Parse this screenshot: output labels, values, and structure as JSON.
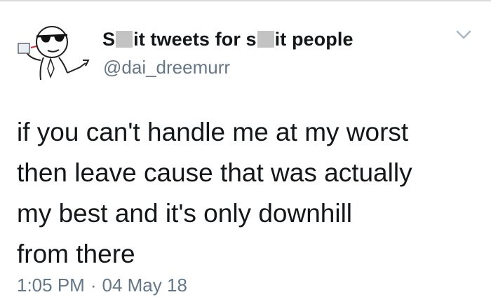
{
  "tweet": {
    "display_name_part1": "S",
    "display_name_part2": "it tweets for s",
    "display_name_part3": "it people",
    "handle": "@dai_dreemurr",
    "text": "if you can't handle me at my worst\nthen leave cause that was actually\nmy best and it's only downhill\nfrom there",
    "time": "1:05 PM",
    "separator": "·",
    "date": "04 May 18"
  },
  "icons": {
    "avatar": "cartoon-sunglasses-avatar",
    "menu": "chevron-down-icon"
  },
  "colors": {
    "text": "#14171a",
    "secondary": "#657786",
    "background": "#ffffff"
  }
}
